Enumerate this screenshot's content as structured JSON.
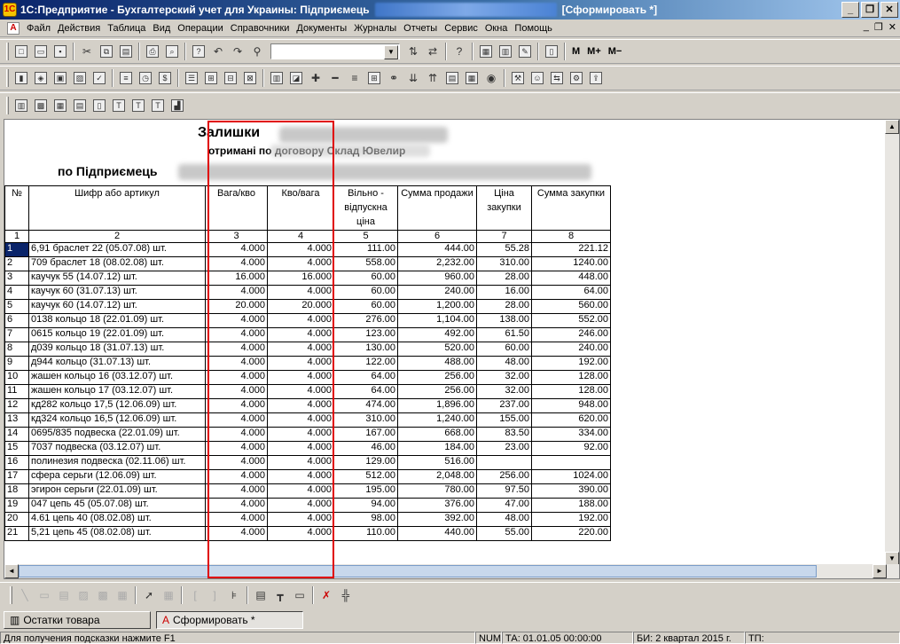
{
  "window": {
    "title_prefix": "1С:Предприятие - Бухгалтерский учет для Украины: Підприємець",
    "title_suffix": "[Сформировать  *]",
    "minimize": "_",
    "restore": "❐",
    "close": "✕"
  },
  "menu": {
    "items": [
      "Файл",
      "Действия",
      "Таблица",
      "Вид",
      "Операции",
      "Справочники",
      "Документы",
      "Журналы",
      "Отчеты",
      "Сервис",
      "Окна",
      "Помощь"
    ],
    "mdi_buttons": [
      "_",
      "❐",
      "✕"
    ]
  },
  "toolbar": {
    "mem_buttons": [
      "M",
      "M+",
      "M−"
    ],
    "combo_value": ""
  },
  "report": {
    "title": "Залишки",
    "subtitle": "отримані по договору Склад Ювелир",
    "org_label": "по Підприємець",
    "columns": [
      {
        "label": "№",
        "num": "1"
      },
      {
        "label": "Шифр або артикул",
        "num": "2"
      },
      {
        "label": "Вага/кво",
        "num": "3"
      },
      {
        "label": "Кво/вага",
        "num": "4"
      },
      {
        "label": "Вільно - відпускна ціна",
        "num": "5"
      },
      {
        "label": "Сумма продажи",
        "num": "6"
      },
      {
        "label": "Ціна закупки",
        "num": "7"
      },
      {
        "label": "Сумма закупки",
        "num": "8"
      }
    ],
    "rows": [
      [
        "1",
        "6,91 браслет 22   (05.07.08) шт.",
        "4.000",
        "4.000",
        "111.00",
        "444.00",
        "55.28",
        "221.12"
      ],
      [
        "2",
        "709 браслет 18   (08.02.08) шт.",
        "4.000",
        "4.000",
        "558.00",
        "2,232.00",
        "310.00",
        "1240.00"
      ],
      [
        "3",
        "каучук 55   (14.07.12) шт.",
        "16.000",
        "16.000",
        "60.00",
        "960.00",
        "28.00",
        "448.00"
      ],
      [
        "4",
        "каучук 60   (31.07.13) шт.",
        "4.000",
        "4.000",
        "60.00",
        "240.00",
        "16.00",
        "64.00"
      ],
      [
        "5",
        "каучук 60   (14.07.12) шт.",
        "20.000",
        "20.000",
        "60.00",
        "1,200.00",
        "28.00",
        "560.00"
      ],
      [
        "6",
        "0138 кольцо 18   (22.01.09) шт.",
        "4.000",
        "4.000",
        "276.00",
        "1,104.00",
        "138.00",
        "552.00"
      ],
      [
        "7",
        "0615 кольцо 19   (22.01.09) шт.",
        "4.000",
        "4.000",
        "123.00",
        "492.00",
        "61.50",
        "246.00"
      ],
      [
        "8",
        "д039 кольцо 18   (31.07.13) шт.",
        "4.000",
        "4.000",
        "130.00",
        "520.00",
        "60.00",
        "240.00"
      ],
      [
        "9",
        "д944 кольцо   (31.07.13) шт.",
        "4.000",
        "4.000",
        "122.00",
        "488.00",
        "48.00",
        "192.00"
      ],
      [
        "10",
        "жашен кольцо 16   (03.12.07) шт.",
        "4.000",
        "4.000",
        "64.00",
        "256.00",
        "32.00",
        "128.00"
      ],
      [
        "11",
        "жашен кольцо 17   (03.12.07) шт.",
        "4.000",
        "4.000",
        "64.00",
        "256.00",
        "32.00",
        "128.00"
      ],
      [
        "12",
        "кд282 кольцо 17,5   (12.06.09) шт.",
        "4.000",
        "4.000",
        "474.00",
        "1,896.00",
        "237.00",
        "948.00"
      ],
      [
        "13",
        "кд324 кольцо 16,5   (12.06.09) шт.",
        "4.000",
        "4.000",
        "310.00",
        "1,240.00",
        "155.00",
        "620.00"
      ],
      [
        "14",
        "0695/835 подвеска   (22.01.09) шт.",
        "4.000",
        "4.000",
        "167.00",
        "668.00",
        "83.50",
        "334.00"
      ],
      [
        "15",
        "7037 подвеска   (03.12.07) шт.",
        "4.000",
        "4.000",
        "46.00",
        "184.00",
        "23.00",
        "92.00"
      ],
      [
        "16",
        "полинезия подвеска   (02.11.06) шт.",
        "4.000",
        "4.000",
        "129.00",
        "516.00",
        "",
        ""
      ],
      [
        "17",
        "сфера серьги   (12.06.09) шт.",
        "4.000",
        "4.000",
        "512.00",
        "2,048.00",
        "256.00",
        "1024.00"
      ],
      [
        "18",
        "эгирон серьги   (22.01.09) шт.",
        "4.000",
        "4.000",
        "195.00",
        "780.00",
        "97.50",
        "390.00"
      ],
      [
        "19",
        "047 цепь 45   (05.07.08) шт.",
        "4.000",
        "4.000",
        "94.00",
        "376.00",
        "47.00",
        "188.00"
      ],
      [
        "20",
        "4.61 цепь 40   (08.02.08) шт.",
        "4.000",
        "4.000",
        "98.00",
        "392.00",
        "48.00",
        "192.00"
      ],
      [
        "21",
        "5,21 цепь 45   (08.02.08) шт.",
        "4.000",
        "4.000",
        "110.00",
        "440.00",
        "55.00",
        "220.00"
      ]
    ]
  },
  "taskbar": {
    "tab1": "Остатки товара",
    "tab2": "Сформировать  *"
  },
  "status": {
    "hint": "Для получения подсказки нажмите F1",
    "num": "NUM",
    "ta": "ТА: 01.01.05  00:00:00",
    "bi": "БИ: 2 квартал 2015 г.",
    "tp": "ТП:"
  },
  "colors": {
    "highlight": "#e00000",
    "selection": "#0a246a"
  }
}
